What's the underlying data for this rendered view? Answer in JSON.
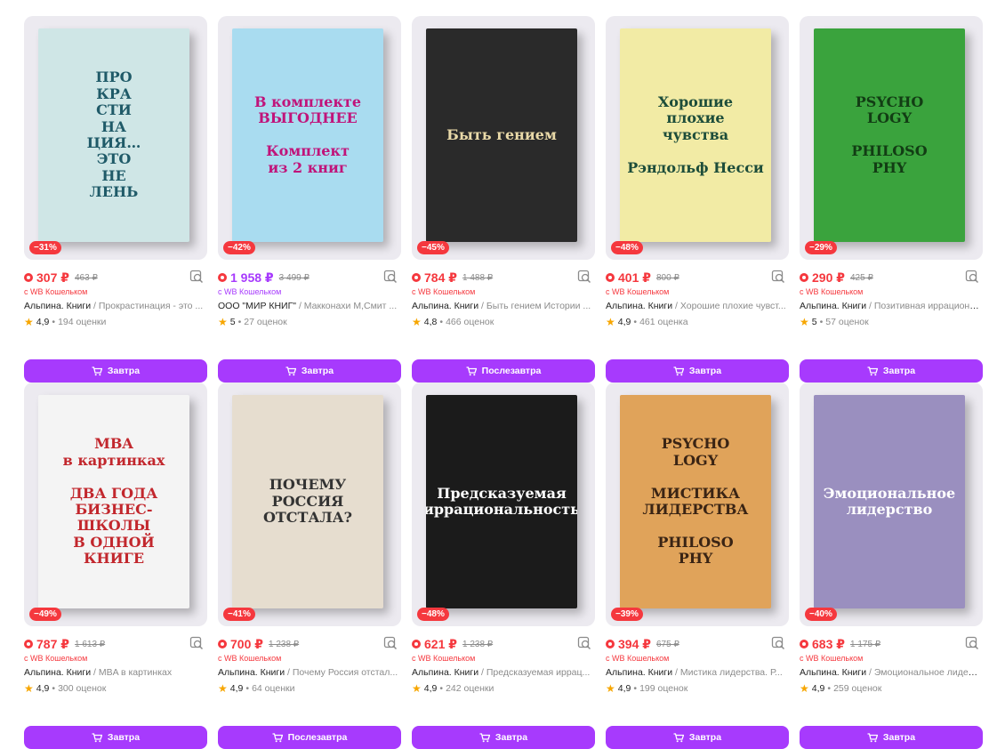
{
  "products": [
    {
      "discount": "−31%",
      "price": "307 ₽",
      "old_price": "463 ₽",
      "wallet": "с WB Кошельком",
      "brand": "Альпина. Книги",
      "name": "Прокрастинация - это ...",
      "rating": "4,9",
      "reviews": "194 оценки",
      "button": "Завтра",
      "cover_text": "ПРО\nКРА\nСТИ\nНА\nЦИЯ…\nЭТО\nНЕ\nЛЕНЬ",
      "cover_bg": "#cfe6e6",
      "cover_fg": "#1f5a68",
      "price_color": "red"
    },
    {
      "discount": "−42%",
      "price": "1 958 ₽",
      "old_price": "3 499 ₽",
      "wallet": "с WB Кошельком",
      "brand": "ООО \"МИР КНИГ\"",
      "name": "Макконахи М,Смит ...",
      "rating": "5",
      "reviews": "27 оценок",
      "button": "Завтра",
      "cover_text": "В комплекте\nВЫГОДНЕЕ\n\nКомплект\nиз 2 книг",
      "cover_bg": "#a9dcf0",
      "cover_fg": "#c0147a",
      "price_color": "purple"
    },
    {
      "discount": "−45%",
      "price": "784 ₽",
      "old_price": "1 488 ₽",
      "wallet": "с WB Кошельком",
      "brand": "Альпина. Книги",
      "name": "Быть гением Истории ...",
      "rating": "4,8",
      "reviews": "466 оценок",
      "button": "Послезавтра",
      "cover_text": "Быть гением",
      "cover_bg": "#2a2a2a",
      "cover_fg": "#e9d9a8",
      "price_color": "red"
    },
    {
      "discount": "−48%",
      "price": "401 ₽",
      "old_price": "800 ₽",
      "wallet": "с WB Кошельком",
      "brand": "Альпина. Книги",
      "name": "Хорошие плохие чувст...",
      "rating": "4,9",
      "reviews": "461 оценка",
      "button": "Завтра",
      "cover_text": "Хорошие\nплохие\nчувства\n\nРэндольф Несси",
      "cover_bg": "#f2eba5",
      "cover_fg": "#1d4d3a",
      "price_color": "red"
    },
    {
      "discount": "−29%",
      "price": "290 ₽",
      "old_price": "425 ₽",
      "wallet": "с WB Кошельком",
      "brand": "Альпина. Книги",
      "name": "Позитивная иррационал...",
      "rating": "5",
      "reviews": "57 оценок",
      "button": "Завтра",
      "cover_text": "PSYCHO\nLOGY\n\nPHILOSO\nPHY",
      "cover_bg": "#3aa33d",
      "cover_fg": "#123d14",
      "price_color": "red"
    },
    {
      "discount": "−49%",
      "price": "787 ₽",
      "old_price": "1 613 ₽",
      "wallet": "с WB Кошельком",
      "brand": "Альпина. Книги",
      "name": "MBA в картинках",
      "rating": "4,9",
      "reviews": "300 оценок",
      "button": "Завтра",
      "cover_text": "MBA\nв картинках\n\nДВА ГОДА\nБИЗНЕС-ШКОЛЫ\nВ ОДНОЙ КНИГЕ",
      "cover_bg": "#f4f4f4",
      "cover_fg": "#c2272d",
      "price_color": "red"
    },
    {
      "discount": "−41%",
      "price": "700 ₽",
      "old_price": "1 238 ₽",
      "wallet": "с WB Кошельком",
      "brand": "Альпина. Книги",
      "name": "Почему Россия отстал...",
      "rating": "4,9",
      "reviews": "64 оценки",
      "button": "Послезавтра",
      "cover_text": "ПОЧЕМУ РОССИЯ\nОТСТАЛА?",
      "cover_bg": "#e6ddcf",
      "cover_fg": "#333333",
      "price_color": "red"
    },
    {
      "discount": "−48%",
      "price": "621 ₽",
      "old_price": "1 238 ₽",
      "wallet": "с WB Кошельком",
      "brand": "Альпина. Книги",
      "name": "Предсказуемая иррац...",
      "rating": "4,9",
      "reviews": "242 оценки",
      "button": "Завтра",
      "cover_text": "Предсказуемая\nиррациональность",
      "cover_bg": "#1b1b1b",
      "cover_fg": "#ffffff",
      "price_color": "red"
    },
    {
      "discount": "−39%",
      "price": "394 ₽",
      "old_price": "675 ₽",
      "wallet": "с WB Кошельком",
      "brand": "Альпина. Книги",
      "name": "Мистика лидерства. Р...",
      "rating": "4,9",
      "reviews": "199 оценок",
      "button": "Завтра",
      "cover_text": "PSYCHO\nLOGY\n\nМИСТИКА\nЛИДЕРСТВА\n\nPHILOSO\nPHY",
      "cover_bg": "#e0a35a",
      "cover_fg": "#3a2414",
      "price_color": "red"
    },
    {
      "discount": "−40%",
      "price": "683 ₽",
      "old_price": "1 175 ₽",
      "wallet": "с WB Кошельком",
      "brand": "Альпина. Книги",
      "name": "Эмоциональное лидерс...",
      "rating": "4,9",
      "reviews": "259 оценок",
      "button": "Завтра",
      "cover_text": "Эмоциональное\nлидерство",
      "cover_bg": "#9a8fbf",
      "cover_fg": "#ffffff",
      "price_color": "red"
    }
  ],
  "separator": " / ",
  "dot": " • ",
  "colors": {
    "accent": "#a73afd",
    "sale": "#f5383e",
    "muted": "#8b8b8b",
    "star": "#f7a600"
  }
}
